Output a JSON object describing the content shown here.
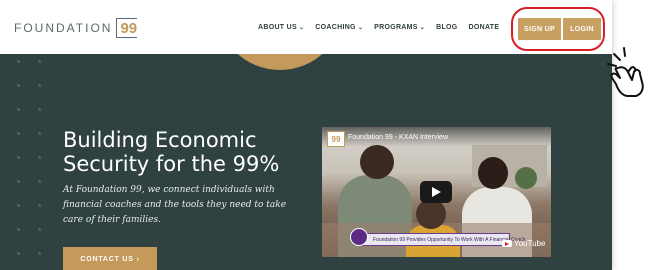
{
  "logo": {
    "text": "FOUNDATION",
    "number": "99"
  },
  "nav": {
    "items": [
      {
        "label": "ABOUT US",
        "dropdown": true
      },
      {
        "label": "COACHING",
        "dropdown": true
      },
      {
        "label": "PROGRAMS",
        "dropdown": true
      },
      {
        "label": "BLOG",
        "dropdown": false
      },
      {
        "label": "DONATE",
        "dropdown": false
      }
    ],
    "chevron": "⌄"
  },
  "buttons": {
    "signup": "SIGN UP",
    "login": "LOGIN"
  },
  "hero": {
    "title_line1": "Building Economic",
    "title_line2": "Security for the 99%",
    "description": "At Foundation 99, we connect individuals with financial coaches and the tools they need to take care of their families.",
    "cta": "CONTACT US  ›"
  },
  "video": {
    "badge": "99",
    "title": "Foundation 99 - KXAN Interview",
    "banner": "Foundation 99 Provides Opportunity To Work With A Financial Coach",
    "platform": "YouTube"
  },
  "colors": {
    "brand_gold": "#c49a5a",
    "hero_bg": "#2f4140",
    "highlight": "#d61f26"
  },
  "icons": [
    "play-icon",
    "youtube-logo-icon",
    "pointing-hand-icon",
    "chevron-down-icon"
  ]
}
